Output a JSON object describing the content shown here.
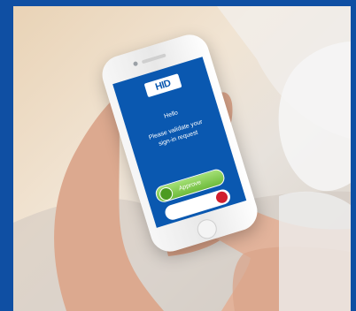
{
  "image": {
    "brand": {
      "logo_text": "HID"
    },
    "screen": {
      "greeting": "Hello",
      "message": "Please validate your sign-in request",
      "approve_label": "Approve"
    },
    "colors": {
      "border_blue": "#0f4fa3",
      "screen_blue": "#0a58b0",
      "approve_green": "#6fbb3c",
      "deny_red": "#d11e2e"
    },
    "icons": {
      "approve": "check-icon",
      "deny": "close-icon"
    }
  }
}
